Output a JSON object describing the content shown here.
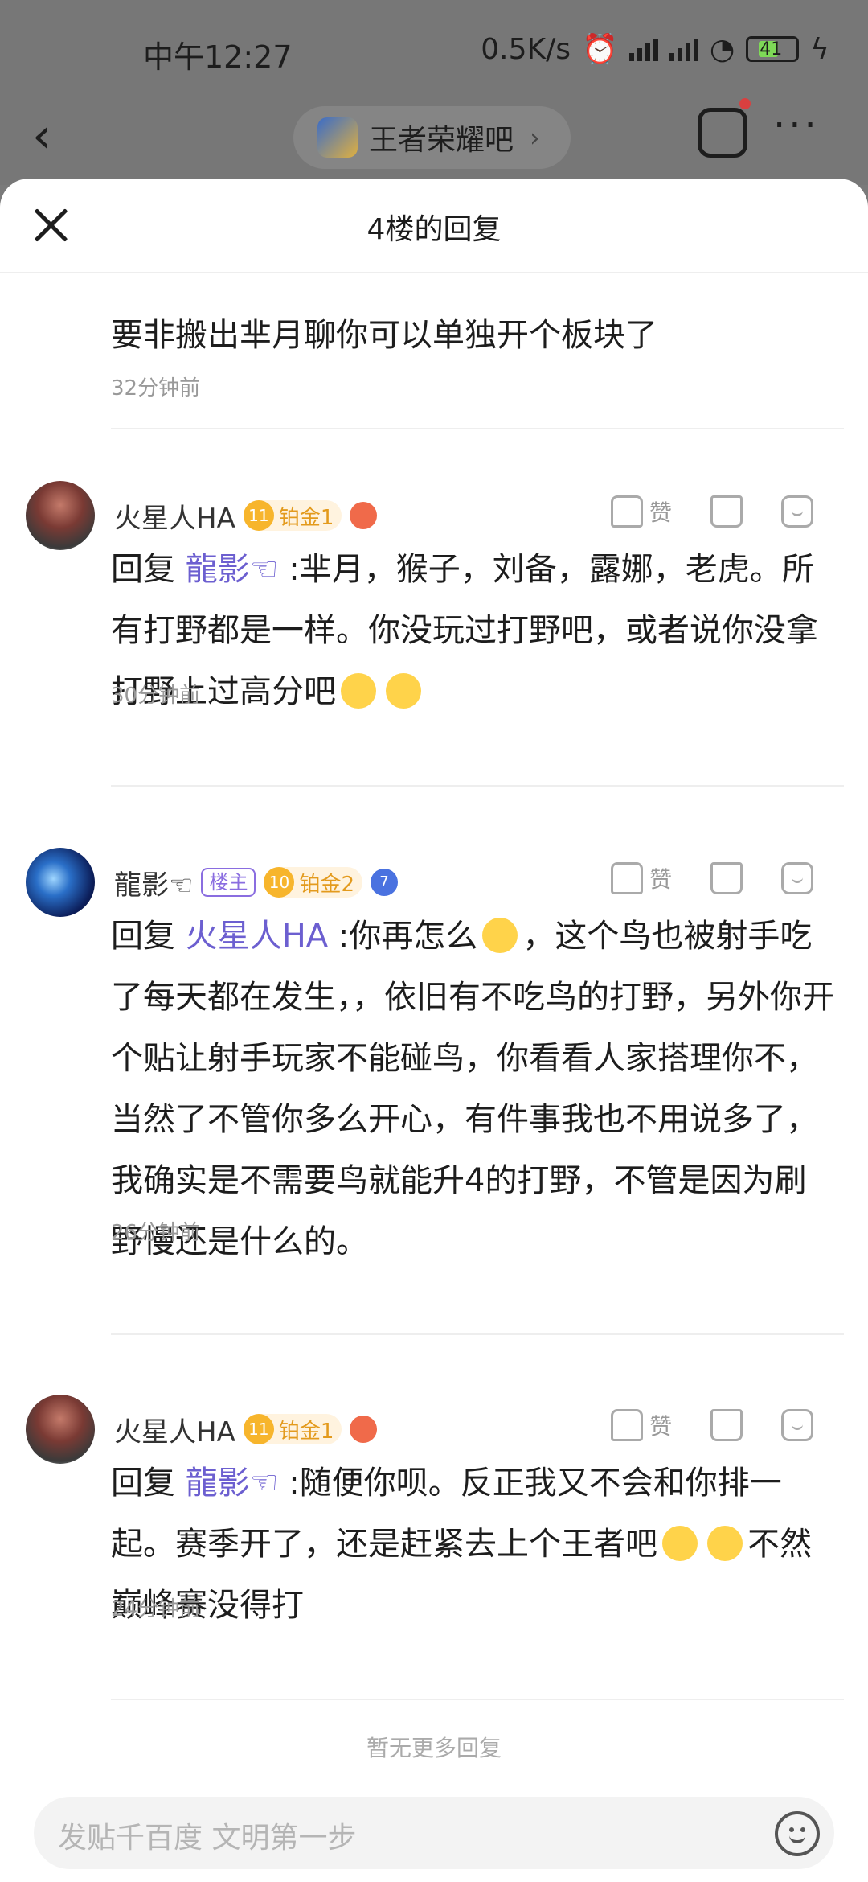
{
  "status": {
    "time": "中午12:27",
    "speed": "0.5K/s",
    "battery": "41"
  },
  "nav": {
    "forum_name": "王者荣耀吧"
  },
  "sheet": {
    "title": "4楼的回复"
  },
  "previous": {
    "text": "要非搬出芈月聊你可以单独开个板块了",
    "time": "32分钟前"
  },
  "replies": [
    {
      "username": "火星人HA",
      "level": "11",
      "rank": "铂金1",
      "prefix": "回复",
      "mention": "龍影☜",
      "text": ":芈月，猴子，刘备，露娜，老虎。所有打野都是一样。你没玩过打野吧，或者说你没拿打野上过高分吧",
      "time": "30分钟前",
      "like_label": "赞"
    },
    {
      "username": "龍影☜",
      "owner_badge": "楼主",
      "level": "10",
      "rank": "铂金2",
      "extra_badge": "7",
      "prefix": "回复",
      "mention": "火星人HA",
      "text_a": ":你再怎么",
      "text_b": "，这个鸟也被射手吃了每天都在发生，，依旧有不吃鸟的打野，另外你开个贴让射手玩家不能碰鸟，你看看人家搭理你不，当然了不管你多么开心，有件事我也不用说多了，我确实是不需要鸟就能升4的打野，不管是因为刷野慢还是什么的。",
      "time": "26分钟前",
      "like_label": "赞"
    },
    {
      "username": "火星人HA",
      "level": "11",
      "rank": "铂金1",
      "prefix": "回复",
      "mention": "龍影☜",
      "text_a": ":随便你呗。反正我又不会和你排一起。赛季开了，还是赶紧去上个王者吧",
      "text_b": "不然巅峰赛没得打",
      "time": "24分钟前",
      "like_label": "赞"
    }
  ],
  "footer": {
    "no_more": "暂无更多回复",
    "input_placeholder": "发贴千百度 文明第一步"
  }
}
